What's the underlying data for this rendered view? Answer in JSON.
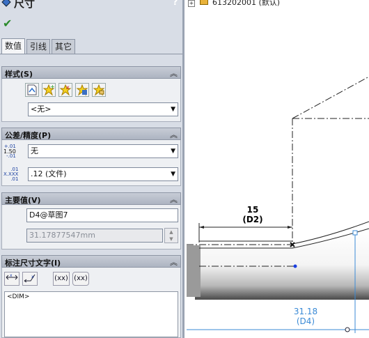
{
  "panel": {
    "title": "尺寸",
    "help": "?",
    "ok": "✔"
  },
  "tabs": [
    "数值",
    "引线",
    "其它"
  ],
  "style_section": {
    "header": "样式(S)",
    "combo_value": "<无>"
  },
  "tolerance_section": {
    "header": "公差/精度(P)",
    "tolerance_type": "无",
    "precision": ".12 (文件)",
    "tol_icon_top": "+.01",
    "tol_icon_mid": "1.50",
    "tol_icon_bot": "-.01",
    "prec_icon_top": ".01",
    "prec_icon_mid": "X.XXX",
    "prec_icon_bot": ".01"
  },
  "primary_section": {
    "header": "主要值(V)",
    "name": "D4@草图7",
    "value": "31.17877547mm"
  },
  "dimtext_section": {
    "header": "标注尺寸文字(I)",
    "btn_paren1": "(xx)",
    "btn_paren2": "(xx)",
    "text": "<DIM>"
  },
  "tree": {
    "label": "613202001 (默认)"
  },
  "drawing": {
    "dim_d2_value": "15",
    "dim_d2_name": "(D2)",
    "dim_d4_value": "31.18",
    "dim_d4_name": "(D4)"
  },
  "colors": {
    "panel_bg": "#d8dde6",
    "section_header": "#b9bfcb",
    "selected_dim": "#3a8ad6",
    "ok_green": "#2a8a2a"
  }
}
